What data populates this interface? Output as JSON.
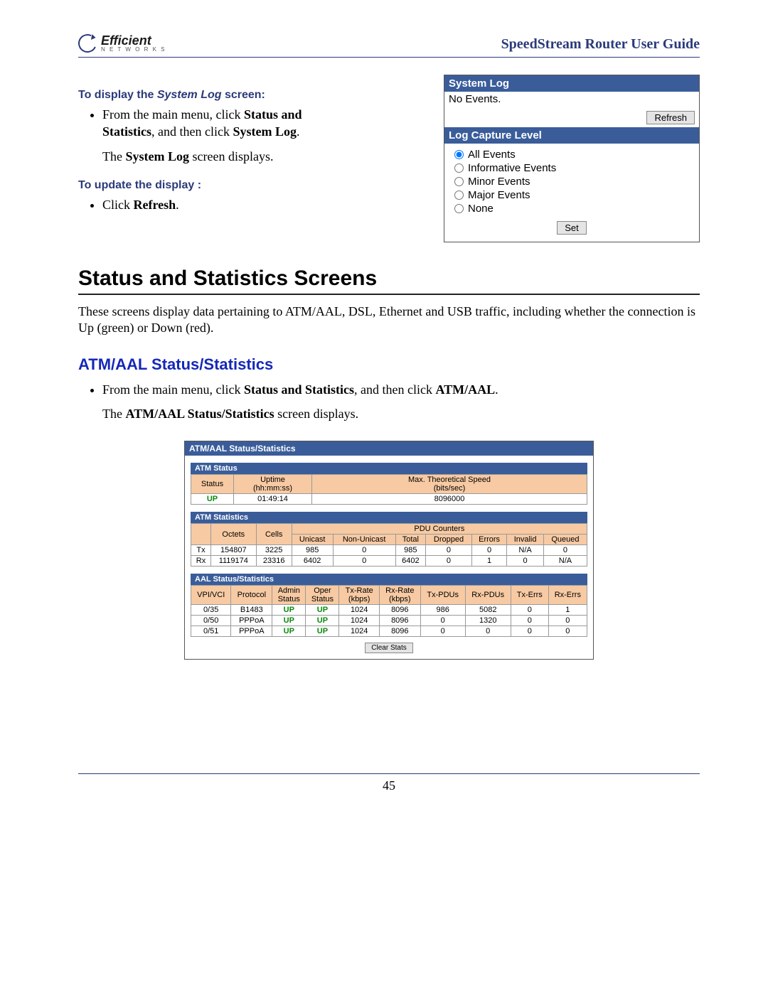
{
  "header": {
    "brand": "Efficient",
    "brand_sub": "N E T W O R K S",
    "doc_title": "SpeedStream Router User Guide"
  },
  "instructions": {
    "sys_log_head": "To display the System Log screen:",
    "sys_log_b1_a": "From the main menu, click ",
    "sys_log_b1_b": "Status and Statistics",
    "sys_log_b1_c": ", and then click ",
    "sys_log_b1_d": "System Log",
    "sys_log_b1_e": ".",
    "sys_log_sub_a": "The ",
    "sys_log_sub_b": "System Log",
    "sys_log_sub_c": " screen displays.",
    "update_head": "To update the display :",
    "update_b1_a": "Click ",
    "update_b1_b": "Refresh",
    "update_b1_c": "."
  },
  "syslog_panel": {
    "title": "System Log",
    "no_events": "No Events.",
    "refresh_btn": "Refresh",
    "capture_head": "Log Capture Level",
    "radios": [
      "All Events",
      "Informative Events",
      "Minor Events",
      "Major Events",
      "None"
    ],
    "selected": "All Events",
    "set_btn": "Set"
  },
  "section_heading": "Status and Statistics Screens",
  "section_para": "These screens display data pertaining to ATM/AAL, DSL, Ethernet and USB traffic, including whether the connection is Up (green) or Down (red).",
  "atm_heading": "ATM/AAL Status/Statistics",
  "atm_b1_a": "From the main menu, click ",
  "atm_b1_b": "Status and Statistics",
  "atm_b1_c": ", and then click ",
  "atm_b1_d": "ATM/AAL",
  "atm_b1_e": ".",
  "atm_sub_a": "The ",
  "atm_sub_b": "ATM/AAL Status/Statistics",
  "atm_sub_c": " screen displays.",
  "atm_shot": {
    "title": "ATM/AAL Status/Statistics",
    "status_sect": "ATM Status",
    "status_headers": {
      "status": "Status",
      "uptime": "Uptime\n(hh:mm:ss)",
      "speed": "Max. Theoretical Speed\n(bits/sec)"
    },
    "status_row": {
      "status": "UP",
      "uptime": "01:49:14",
      "speed": "8096000"
    },
    "stats_sect": "ATM Statistics",
    "stats_headers": {
      "blank": "",
      "octets": "Octets",
      "cells": "Cells",
      "pdu": "PDU Counters",
      "unicast": "Unicast",
      "nonuni": "Non-Unicast",
      "total": "Total",
      "dropped": "Dropped",
      "errors": "Errors",
      "invalid": "Invalid",
      "queued": "Queued"
    },
    "stats_rows": [
      {
        "dir": "Tx",
        "octets": "154807",
        "cells": "3225",
        "uni": "985",
        "nonuni": "0",
        "total": "985",
        "dropped": "0",
        "errors": "0",
        "invalid": "N/A",
        "queued": "0"
      },
      {
        "dir": "Rx",
        "octets": "1119174",
        "cells": "23316",
        "uni": "6402",
        "nonuni": "0",
        "total": "6402",
        "dropped": "0",
        "errors": "1",
        "invalid": "0",
        "queued": "N/A"
      }
    ],
    "aal_sect": "AAL Status/Statistics",
    "aal_headers": {
      "vpivci": "VPI/VCI",
      "proto": "Protocol",
      "admin": "Admin\nStatus",
      "oper": "Oper\nStatus",
      "txrate": "Tx-Rate\n(kbps)",
      "rxrate": "Rx-Rate\n(kbps)",
      "txpdu": "Tx-PDUs",
      "rxpdu": "Rx-PDUs",
      "txerr": "Tx-Errs",
      "rxerr": "Rx-Errs"
    },
    "aal_rows": [
      {
        "vpivci": "0/35",
        "proto": "B1483",
        "admin": "UP",
        "oper": "UP",
        "txrate": "1024",
        "rxrate": "8096",
        "txpdu": "986",
        "rxpdu": "5082",
        "txerr": "0",
        "rxerr": "1"
      },
      {
        "vpivci": "0/50",
        "proto": "PPPoA",
        "admin": "UP",
        "oper": "UP",
        "txrate": "1024",
        "rxrate": "8096",
        "txpdu": "0",
        "rxpdu": "1320",
        "txerr": "0",
        "rxerr": "0"
      },
      {
        "vpivci": "0/51",
        "proto": "PPPoA",
        "admin": "UP",
        "oper": "UP",
        "txrate": "1024",
        "rxrate": "8096",
        "txpdu": "0",
        "rxpdu": "0",
        "txerr": "0",
        "rxerr": "0"
      }
    ],
    "clear_btn": "Clear Stats"
  },
  "page_number": "45"
}
